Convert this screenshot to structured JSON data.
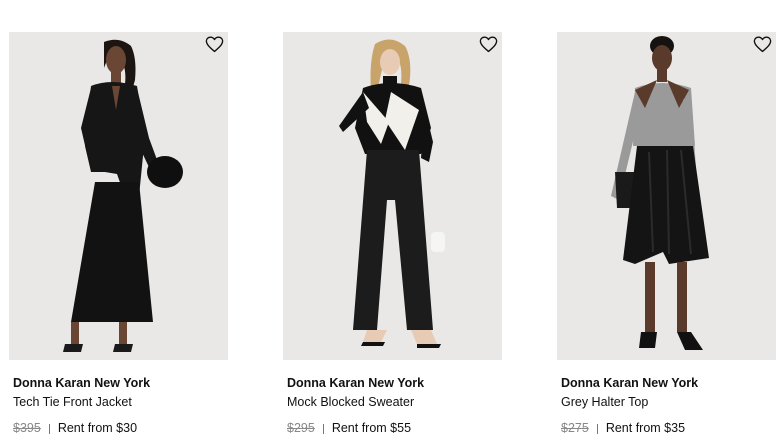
{
  "products": [
    {
      "brand": "Donna Karan New York",
      "name": "Tech Tie Front Jacket",
      "retail_price": "$395",
      "rent_price": "Rent from $30",
      "favorite_icon": "heart-outline-icon"
    },
    {
      "brand": "Donna Karan New York",
      "name": "Mock Blocked Sweater",
      "retail_price": "$295",
      "rent_price": "Rent from $55",
      "favorite_icon": "heart-outline-icon"
    },
    {
      "brand": "Donna Karan New York",
      "name": "Grey Halter Top",
      "retail_price": "$275",
      "rent_price": "Rent from $35",
      "favorite_icon": "heart-outline-icon"
    }
  ],
  "colors": {
    "photo_background": "#e9e8e6",
    "strikethrough_price": "#888888",
    "text": "#111111"
  }
}
